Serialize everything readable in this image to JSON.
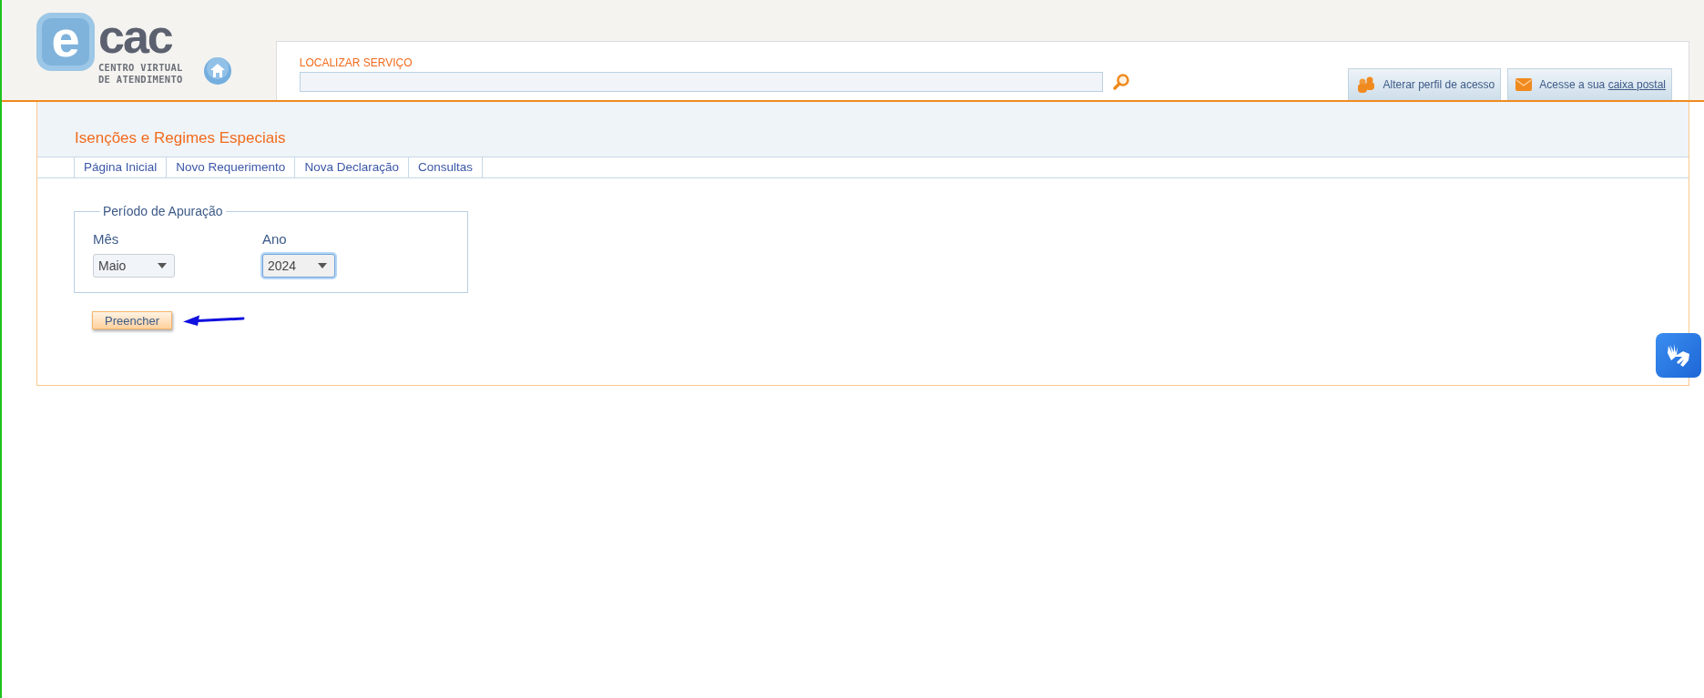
{
  "logo": {
    "letter": "e",
    "word": "cac",
    "tagline_1": "CENTRO VIRTUAL",
    "tagline_2": "DE ATENDIMENTO"
  },
  "search": {
    "label": "LOCALIZAR SERVIÇO"
  },
  "header_buttons": [
    {
      "kind": "profile",
      "text": "Alterar perfil de acesso"
    },
    {
      "kind": "mail",
      "text": "Acesse a sua ",
      "link": "caixa postal"
    }
  ],
  "section": {
    "title": "Isenções e Regimes Especiais"
  },
  "tabs": [
    {
      "label": "Página Inicial"
    },
    {
      "label": "Novo Requerimento"
    },
    {
      "label": "Nova Declaração"
    },
    {
      "label": "Consultas"
    }
  ],
  "fieldset": {
    "legend": "Período de Apuração",
    "selects": [
      {
        "label": "Mês",
        "value": "Maio",
        "focused": false
      },
      {
        "label": "Ano",
        "value": "2024",
        "focused": true
      }
    ]
  },
  "submit_button": "Preencher"
}
